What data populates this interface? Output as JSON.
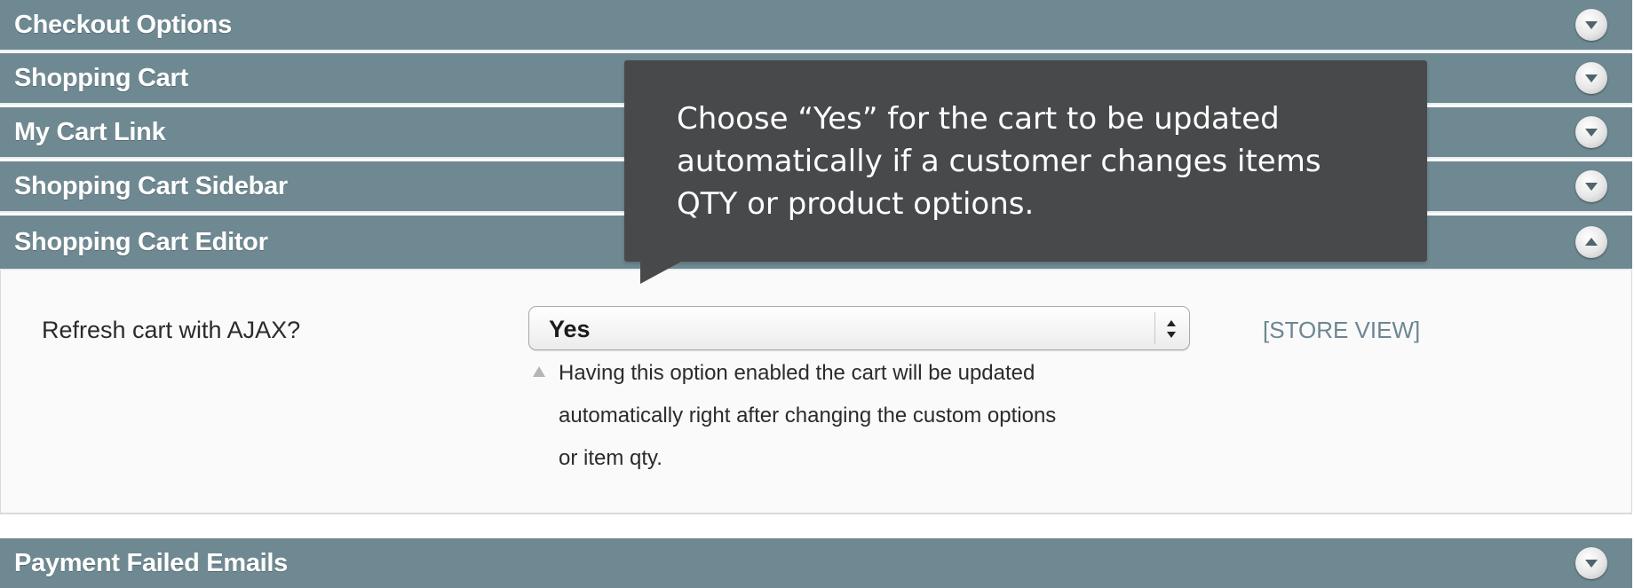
{
  "sections": [
    {
      "title": "Checkout Options",
      "state": "collapsed"
    },
    {
      "title": "Shopping Cart",
      "state": "collapsed"
    },
    {
      "title": "My Cart Link",
      "state": "collapsed"
    },
    {
      "title": "Shopping Cart Sidebar",
      "state": "collapsed"
    },
    {
      "title": "Shopping Cart Editor",
      "state": "expanded"
    },
    {
      "title": "Payment Failed Emails",
      "state": "collapsed"
    }
  ],
  "editor": {
    "field_label": "Refresh cart with AJAX?",
    "select_value": "Yes",
    "scope": "[STORE VIEW]",
    "note_lines": [
      "Having this option enabled the cart will be updated",
      "automatically right after changing the custom options",
      "or item qty."
    ]
  },
  "tooltip": {
    "lines": [
      "Choose “Yes” for the cart to be updated",
      "automatically if a customer changes items",
      "QTY or product options."
    ]
  },
  "colors": {
    "header_bg": "#6f8992",
    "tooltip_bg": "#48494b",
    "scope_text": "#6d8692"
  },
  "icons": {
    "collapsed": "chevron-down-icon",
    "expanded": "chevron-up-icon",
    "select": "select-arrows-icon",
    "note": "note-arrow-icon"
  }
}
